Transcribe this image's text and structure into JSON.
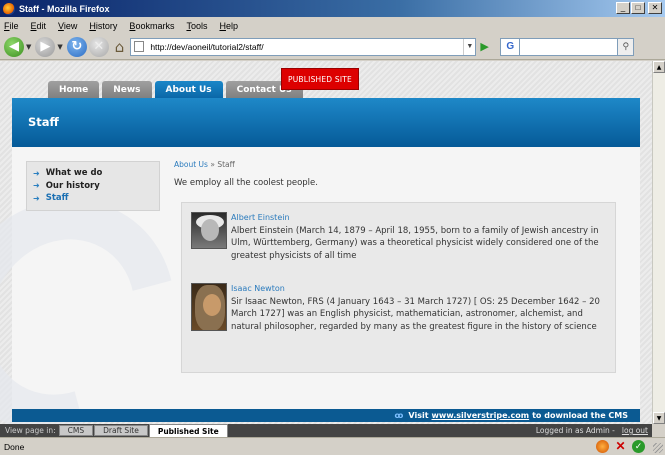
{
  "window": {
    "title": "Staff - Mozilla Firefox",
    "buttons": [
      "_",
      "□",
      "✕"
    ]
  },
  "menu": [
    "File",
    "Edit",
    "View",
    "History",
    "Bookmarks",
    "Tools",
    "Help"
  ],
  "toolbar": {
    "url": "http://dev/aoneil/tutorial2/staff/",
    "search_engine": "G",
    "search_placeholder": ""
  },
  "site": {
    "tabs": [
      {
        "label": "Home",
        "active": false
      },
      {
        "label": "News",
        "active": false
      },
      {
        "label": "About Us",
        "active": true
      },
      {
        "label": "Contact Us",
        "active": false
      }
    ],
    "published_badge": "PUBLISHED SITE",
    "header_title": "Staff",
    "subnav": [
      {
        "label": "What we do",
        "current": false
      },
      {
        "label": "Our history",
        "current": false
      },
      {
        "label": "Staff",
        "current": true
      }
    ],
    "breadcrumb": {
      "parent": "About Us",
      "separator": "»",
      "current": "Staff"
    },
    "intro": "We employ all the coolest people.",
    "staff": [
      {
        "name": "Albert Einstein",
        "bio": "Albert Einstein (March 14, 1879 – April 18, 1955, born to a family of Jewish ancestry in Ulm, Württemberg, Germany) was a theoretical physicist widely considered one of the greatest physicists of all time"
      },
      {
        "name": "Isaac Newton",
        "bio": "Sir Isaac Newton, FRS (4 January 1643 – 31 March 1727) [ OS: 25 December 1642 – 20 March 1727] was an English physicist, mathematician, astronomer, alchemist, and natural philosopher, regarded by many as the greatest figure in the history of science"
      }
    ],
    "footer": {
      "visit": "Visit",
      "link": "www.silverstripe.com",
      "suffix": "to download the CMS"
    }
  },
  "cms_bar": {
    "view_label": "View page in:",
    "buttons": [
      {
        "label": "CMS",
        "selected": false
      },
      {
        "label": "Draft Site",
        "selected": false
      },
      {
        "label": "Published Site",
        "selected": true
      }
    ],
    "logged_in": "Logged in as Admin -",
    "logout": "log out"
  },
  "status": {
    "text": "Done"
  }
}
